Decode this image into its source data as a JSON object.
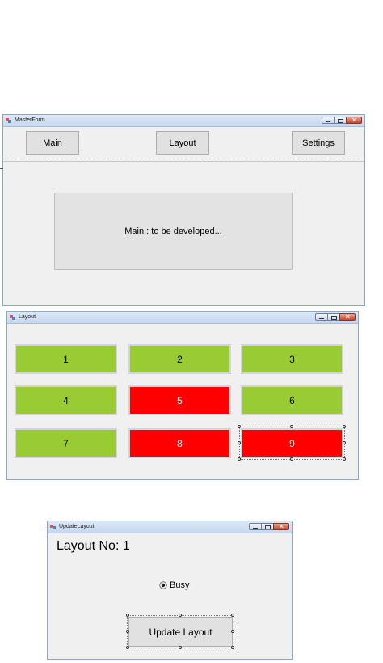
{
  "master_form": {
    "title": "MasterForm",
    "buttons": {
      "main": "Main",
      "layout": "Layout",
      "settings": "Settings"
    },
    "content_label": "Main : to be developed..."
  },
  "layout_form": {
    "title": "Layout",
    "tiles": [
      {
        "label": "1",
        "status": "green"
      },
      {
        "label": "2",
        "status": "green"
      },
      {
        "label": "3",
        "status": "green"
      },
      {
        "label": "4",
        "status": "green"
      },
      {
        "label": "5",
        "status": "red"
      },
      {
        "label": "6",
        "status": "green"
      },
      {
        "label": "7",
        "status": "green"
      },
      {
        "label": "8",
        "status": "red"
      },
      {
        "label": "9",
        "status": "red"
      }
    ],
    "colors": {
      "green": "#99cc33",
      "red": "#ff0000"
    }
  },
  "update_layout_form": {
    "title": "UpdateLayout",
    "layout_no_label": "Layout No: 1",
    "radio_label": "Busy",
    "radio_checked": true,
    "update_button": "Update Layout"
  }
}
